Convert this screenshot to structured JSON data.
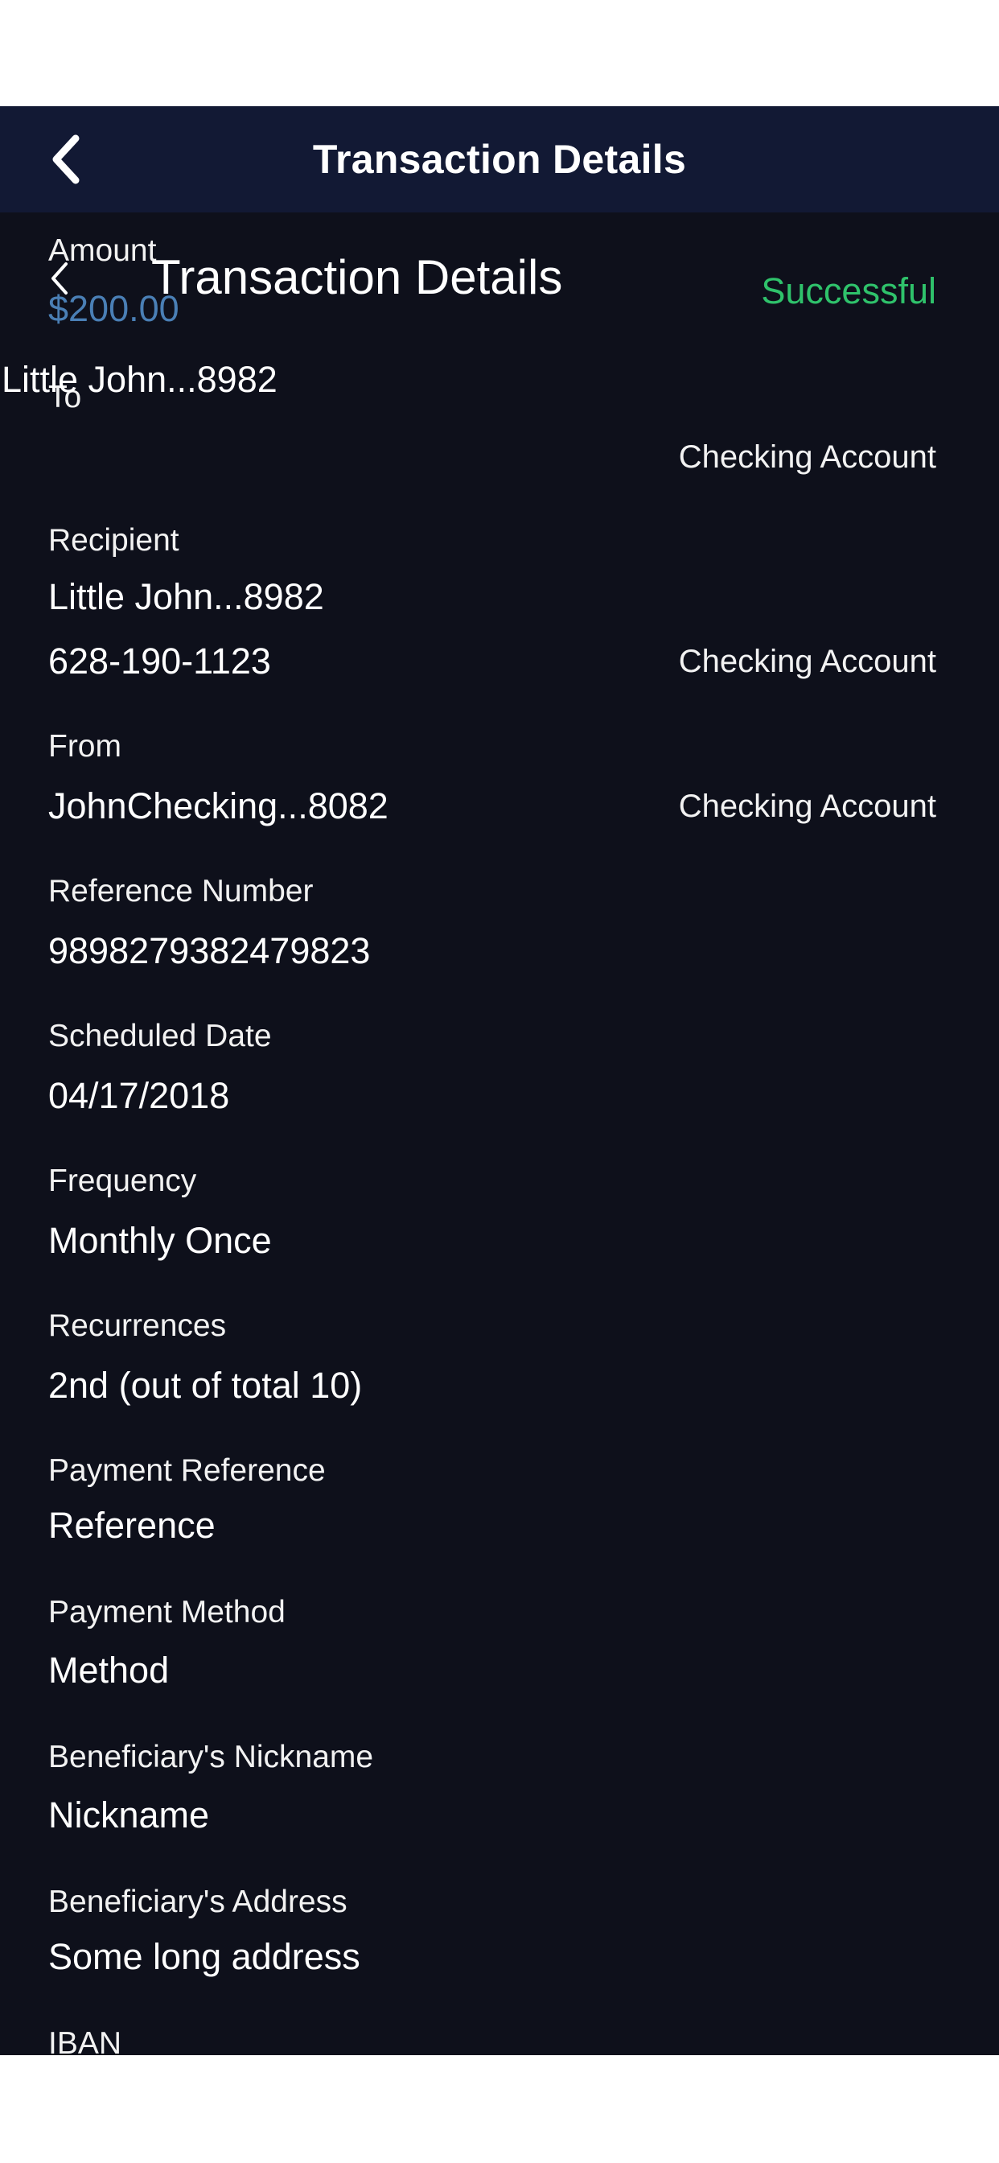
{
  "header": {
    "title": "Transaction Details"
  },
  "overlay": {
    "title": "Transaction Details"
  },
  "summary": {
    "amount_label": "Amount",
    "amount": "$200.00",
    "status": "Successful",
    "to_label": "To",
    "to_value": "Little John...8982",
    "to_account_type": "Checking Account"
  },
  "details": [
    {
      "label": "Recipient",
      "value": "Little John...8982"
    },
    {
      "label": "Reference Number",
      "value": "9898279382479823"
    },
    {
      "label": "Scheduled Date",
      "value": "04/17/2018"
    },
    {
      "label": "Frequency",
      "value": "Monthly Once"
    },
    {
      "label": "Recurrences",
      "value": "2nd (out of total 10)"
    },
    {
      "label": "Payment Reference",
      "value": "Reference"
    },
    {
      "label": "Payment Method",
      "value": "Method"
    },
    {
      "label": "Beneficiary's Nickname",
      "value": "Nickname"
    },
    {
      "label": "Beneficiary's Address",
      "value": "Some long address"
    },
    {
      "label": "IBAN",
      "value": ""
    }
  ],
  "recipient_phone": "628-190-1123",
  "recipient_account_type": "Checking Account",
  "from": {
    "label": "From",
    "value": "JohnChecking...8082",
    "account_type": "Checking Account"
  },
  "colors": {
    "header_bg": "#121934",
    "content_bg": "#0e101b",
    "amount": "#4a7fb5",
    "status": "#2fc26b"
  },
  "icons": {
    "header_back": "chevron-left-icon",
    "overlay_back": "chevron-left-icon"
  }
}
